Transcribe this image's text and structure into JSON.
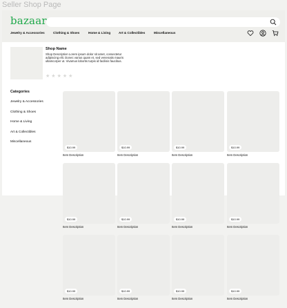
{
  "page_label": "Seller Shop Page",
  "header": {
    "logo": "bazaar",
    "nav": [
      "Jewelry & Accessories",
      "Clothing & Shoes",
      "Home & Living",
      "Art & Collectibles",
      "Miscellaneous"
    ],
    "icons": [
      "search-icon",
      "heart-icon",
      "account-icon",
      "cart-icon"
    ]
  },
  "shop": {
    "name": "Shop Name",
    "description": "Shop Description Lorem ipsum dolor sit amet, consectetur adipiscing elit. Donec varius quam et, sed venenatis mauris ullamcorper ut. Vivamus lobortis turpis id facilisis faucibus.",
    "rating": 0,
    "rating_max": 5
  },
  "sidebar": {
    "title": "Categories",
    "items": [
      "Jewelry & Accessories",
      "Clothing & Shoes",
      "Home & Living",
      "Art & Collectibles",
      "Miscellaneous"
    ]
  },
  "products": [
    {
      "price": "$10.99",
      "desc": "Item Description"
    },
    {
      "price": "$10.99",
      "desc": "Item Description"
    },
    {
      "price": "$10.99",
      "desc": "Item Description"
    },
    {
      "price": "$10.99",
      "desc": "Item Description"
    },
    {
      "price": "$10.99",
      "desc": "Item Description"
    },
    {
      "price": "$10.99",
      "desc": "Item Description"
    },
    {
      "price": "$10.99",
      "desc": "Item Description"
    },
    {
      "price": "$10.99",
      "desc": "Item Description"
    },
    {
      "price": "$10.99",
      "desc": "Item Description"
    },
    {
      "price": "$10.99",
      "desc": "Item Description"
    },
    {
      "price": "$10.99",
      "desc": "Item Description"
    },
    {
      "price": "$10.99",
      "desc": "Item Description"
    }
  ]
}
